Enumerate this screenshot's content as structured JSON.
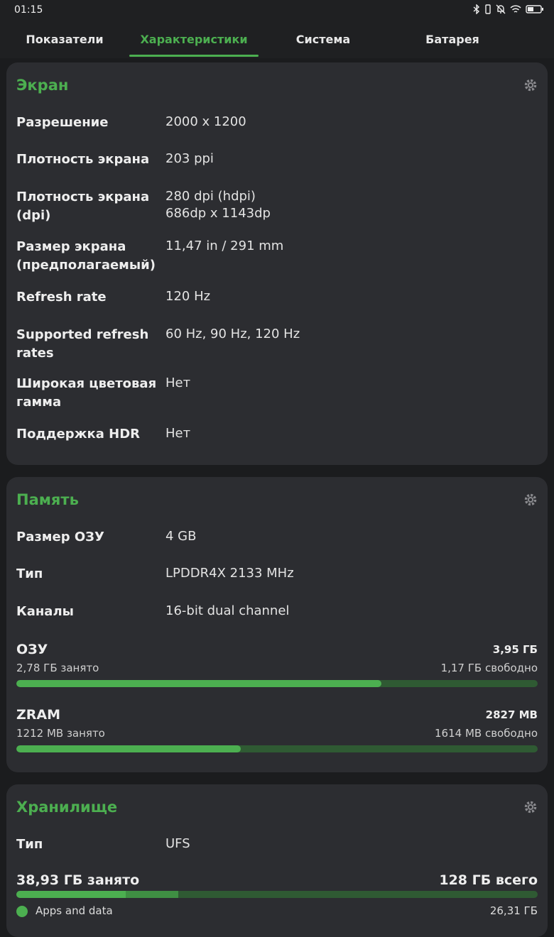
{
  "status_bar": {
    "time": "01:15"
  },
  "tabs": [
    {
      "label": "Показатели"
    },
    {
      "label": "Характеристики"
    },
    {
      "label": "Система"
    },
    {
      "label": "Батарея"
    }
  ],
  "active_tab": "Характеристики",
  "colors": {
    "accent": "#4caf50",
    "card_bg": "#2c2d31",
    "bar_track": "#2f5a33",
    "page_bg": "#1b1c1e"
  },
  "screen": {
    "title": "Экран",
    "rows": [
      {
        "label": "Разрешение",
        "value": "2000 x 1200"
      },
      {
        "label": "Плотность экрана",
        "value": "203 ppi"
      },
      {
        "label": "Плотность экрана (dpi)",
        "value": "280 dpi (hdpi)\n686dp x 1143dp"
      },
      {
        "label": "Размер экрана (предполагаемый)",
        "value": "11,47 in / 291 mm"
      },
      {
        "label": "Refresh rate",
        "value": "120 Hz"
      },
      {
        "label": "Supported refresh rates",
        "value": "60 Hz, 90 Hz, 120 Hz"
      },
      {
        "label": "Широкая цветовая гамма",
        "value": "Нет"
      },
      {
        "label": "Поддержка HDR",
        "value": "Нет"
      }
    ]
  },
  "memory": {
    "title": "Память",
    "rows": [
      {
        "label": "Размер ОЗУ",
        "value": "4 GB"
      },
      {
        "label": "Тип",
        "value": "LPDDR4X 2133 MHz"
      },
      {
        "label": "Каналы",
        "value": "16-bit dual channel"
      }
    ],
    "ram": {
      "name": "ОЗУ",
      "total": "3,95 ГБ",
      "used": "2,78 ГБ занято",
      "free": "1,17 ГБ свободно",
      "fraction": 0.7
    },
    "zram": {
      "name": "ZRAM",
      "total": "2827 MB",
      "used": "1212 MB занято",
      "free": "1614 MB свободно",
      "fraction": 0.43
    }
  },
  "storage": {
    "title": "Хранилище",
    "rows": [
      {
        "label": "Тип",
        "value": "UFS"
      }
    ],
    "used": "38,93 ГБ занято",
    "total": "128 ГБ всего",
    "segments": [
      {
        "fraction": 0.21,
        "color": "#4caf50"
      },
      {
        "fraction": 0.1,
        "color": "#3f8f43"
      }
    ],
    "legend": [
      {
        "label": "Apps and data",
        "value": "26,31 ГБ",
        "color": "#4caf50"
      }
    ]
  }
}
